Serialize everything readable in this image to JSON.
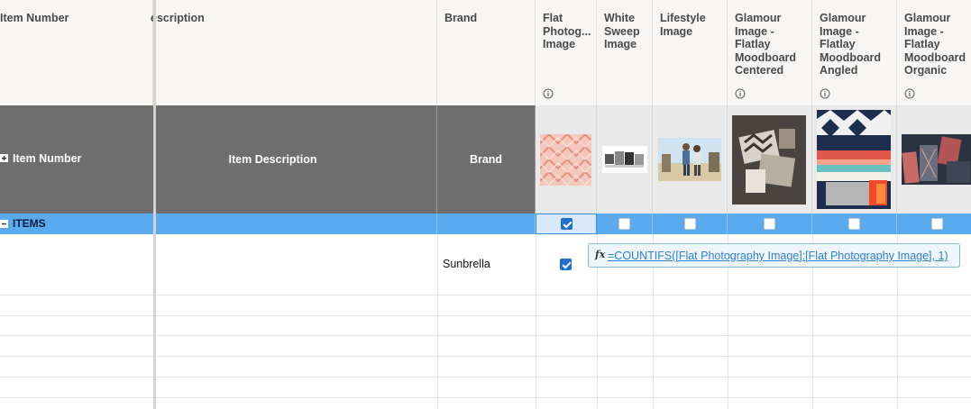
{
  "header": {
    "columns": [
      {
        "label": "Item Number"
      },
      {
        "label": "escription"
      },
      {
        "label": "Brand"
      },
      {
        "label": "Flat\nPhotog...\nImage"
      },
      {
        "label": "White\nSweep\nImage"
      },
      {
        "label": "Lifestyle\nImage"
      },
      {
        "label": "Glamour\nImage -\nFlatlay\nMoodboard\nCentered"
      },
      {
        "label": "Glamour\nImage -\nFlatlay\nMoodboard\nAngled"
      },
      {
        "label": "Glamour\nImage -\nFlatlay\nMoodboard\nOrganic"
      }
    ],
    "info_icon": "info-icon"
  },
  "summary_row": {
    "item_number": "Item Number",
    "item_description": "Item Description",
    "brand": "Brand",
    "expand_icon": "plus-icon"
  },
  "items_row": {
    "label": "ITEMS",
    "collapse_icon": "minus-icon",
    "checkboxes": [
      true,
      false,
      false,
      false,
      false,
      false
    ]
  },
  "data_row": {
    "brand": "Sunbrella",
    "flat_photography_checked": true
  },
  "formula_tooltip": {
    "fx_label": "fx",
    "formula": "=COUNTIFS([Flat Photography Image]:[Flat Photography Image], 1)"
  },
  "colors": {
    "header_bg": "#f7f6f4",
    "summary_bg": "#6e6e6e",
    "items_bg": "#5aaaf0",
    "checkbox_on": "#1f6fd1",
    "link": "#2d7fd1"
  }
}
